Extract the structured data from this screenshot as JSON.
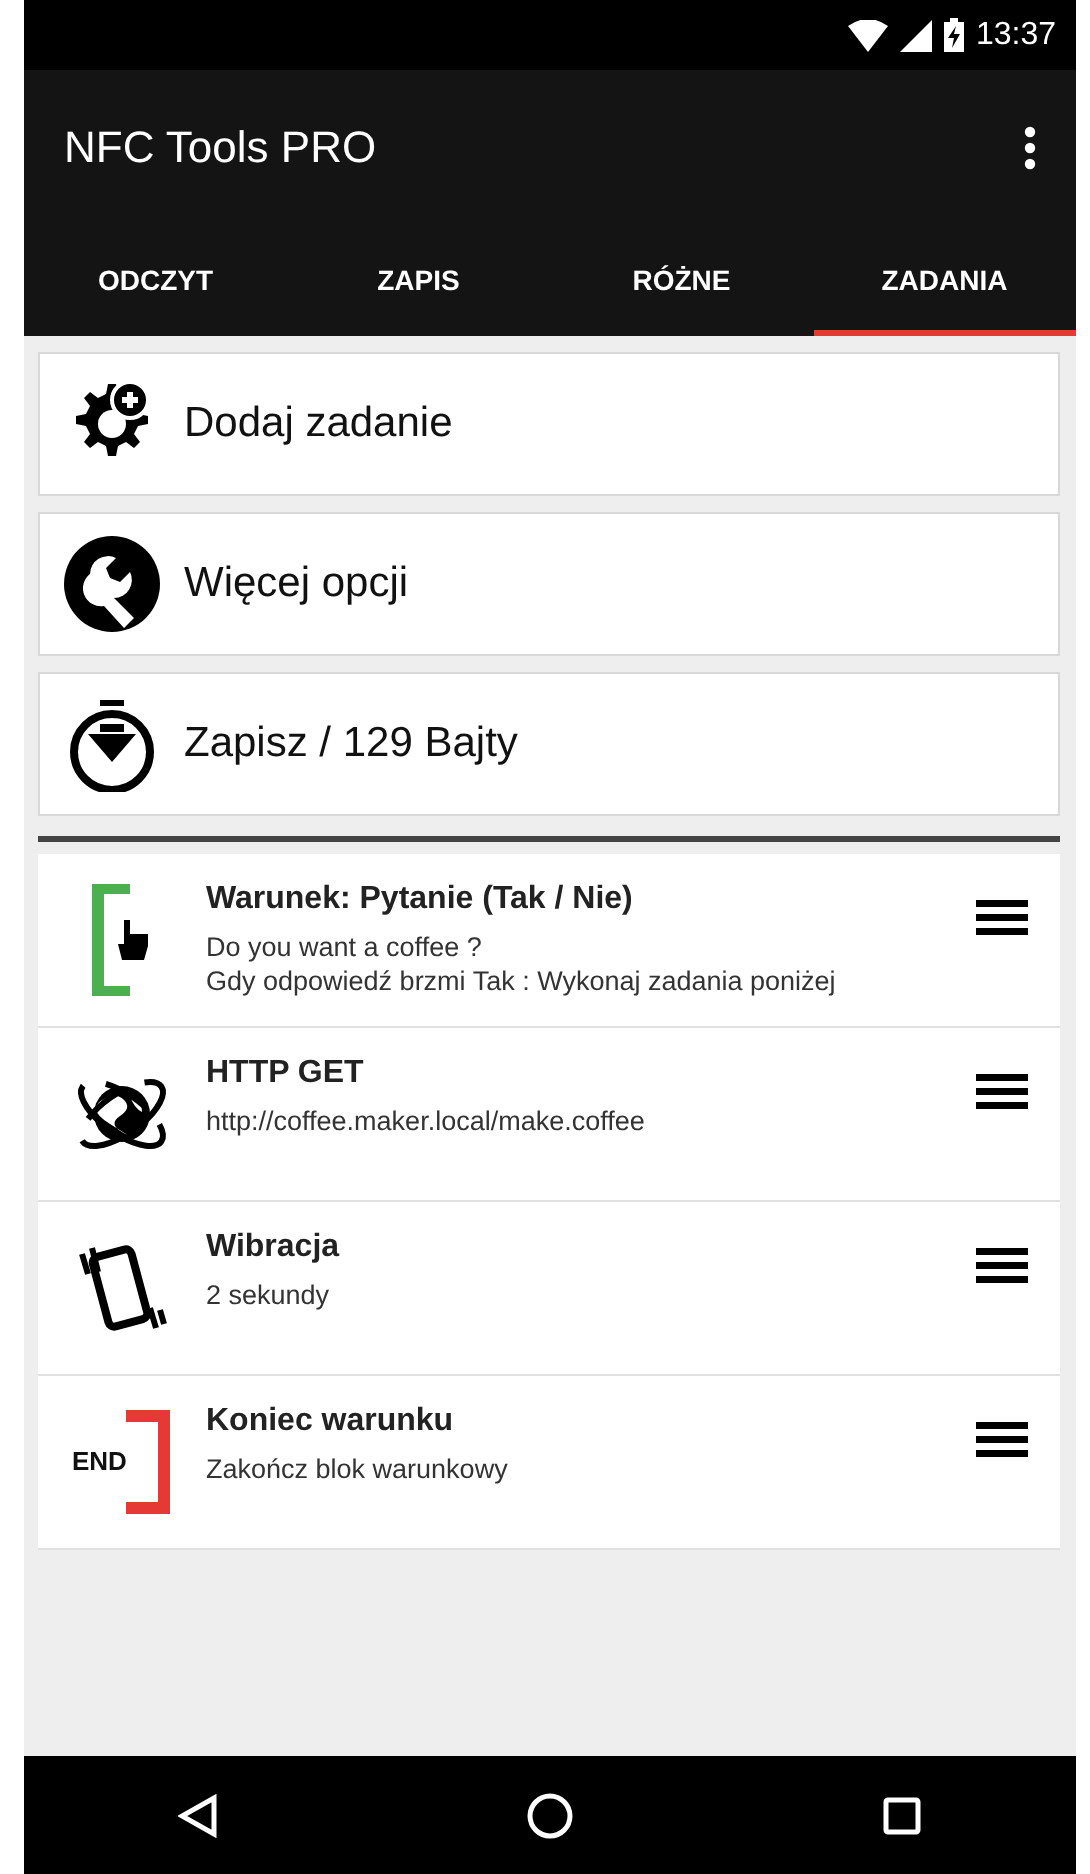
{
  "status_bar": {
    "time": "13:37"
  },
  "toolbar": {
    "title": "NFC Tools PRO"
  },
  "tabs": [
    {
      "label": "ODCZYT",
      "selected": false
    },
    {
      "label": "ZAPIS",
      "selected": false
    },
    {
      "label": "RÓŻNE",
      "selected": false
    },
    {
      "label": "ZADANIA",
      "selected": true
    }
  ],
  "actions": [
    {
      "kind": "add",
      "label": "Dodaj zadanie"
    },
    {
      "kind": "options",
      "label": "Więcej opcji"
    },
    {
      "kind": "write",
      "label": "Zapisz / 129 Bajty"
    }
  ],
  "tasks": [
    {
      "kind": "condition",
      "title": "Warunek: Pytanie (Tak / Nie)",
      "lines": [
        "Do you want a coffee ?",
        "Gdy odpowiedź brzmi Tak : Wykonaj zadania poniżej"
      ]
    },
    {
      "kind": "http",
      "title": "HTTP GET",
      "lines": [
        "http://coffee.maker.local/make.coffee"
      ]
    },
    {
      "kind": "vibrate",
      "title": "Wibracja",
      "lines": [
        "2 sekundy"
      ]
    },
    {
      "kind": "end",
      "icon_text": "END",
      "title": "Koniec warunku",
      "lines": [
        "Zakończ blok warunkowy"
      ]
    }
  ]
}
